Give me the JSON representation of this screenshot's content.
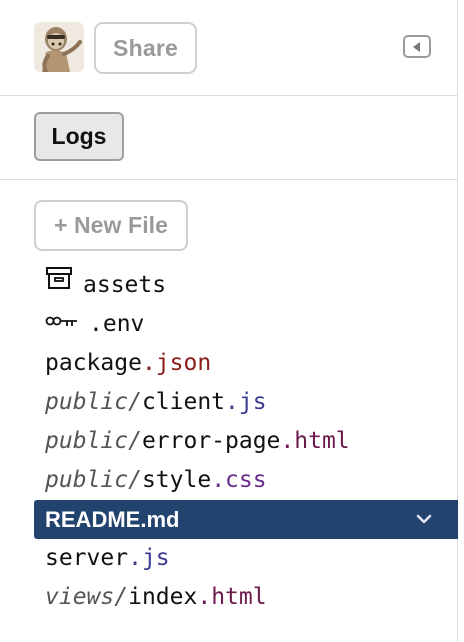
{
  "header": {
    "share_label": "Share"
  },
  "tools": {
    "logs_label": "Logs",
    "new_file_label": "+ New File"
  },
  "files": [
    {
      "icon": "archive-icon",
      "base": "assets",
      "ext": "",
      "dir": ""
    },
    {
      "icon": "key-icon",
      "base": ".env",
      "ext": "",
      "dir": ""
    },
    {
      "icon": "",
      "base": "package",
      "ext": ".json",
      "dir": ""
    },
    {
      "icon": "",
      "base": "client",
      "ext": ".js",
      "dir": "public/"
    },
    {
      "icon": "",
      "base": "error-page",
      "ext": ".html",
      "dir": "public/"
    },
    {
      "icon": "",
      "base": "style",
      "ext": ".css",
      "dir": "public/"
    },
    {
      "icon": "",
      "base": "README",
      "ext": ".md",
      "dir": "",
      "selected": true
    },
    {
      "icon": "",
      "base": "server",
      "ext": ".js",
      "dir": ""
    },
    {
      "icon": "",
      "base": "index",
      "ext": ".html",
      "dir": "views/"
    }
  ],
  "colors": {
    "selected_bg": "#23436f",
    "json_ext": "#8b1b1b",
    "js_ext": "#3b3b8f",
    "html_ext": "#6b1b4d",
    "css_ext": "#6a2d8a"
  }
}
